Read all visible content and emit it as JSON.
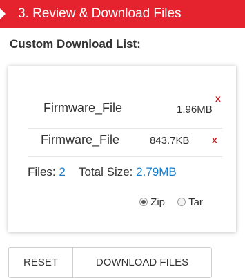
{
  "step": {
    "title": "3. Review & Download Files"
  },
  "section": {
    "title": "Custom Download List:"
  },
  "files": [
    {
      "name": "Firmware_File",
      "size": "1.96MB",
      "remove_symbol": "x"
    },
    {
      "name": "Firmware_File",
      "size": "843.7KB",
      "remove_symbol": "x"
    }
  ],
  "summary": {
    "files_label": "Files:",
    "files_count": "2",
    "total_label": "Total Size:",
    "total_value": "2.79MB"
  },
  "format": {
    "options": [
      "Zip",
      "Tar"
    ],
    "selected": "Zip"
  },
  "buttons": {
    "reset": "RESET",
    "download": "DOWNLOAD FILES"
  },
  "colors": {
    "header_bg": "#e5232f",
    "remove": "#cc1f27",
    "accent": "#1a7cc9"
  },
  "icons": {
    "step": "arrow-right-icon",
    "remove": "remove-x-icon",
    "radio": "radio-icon"
  }
}
